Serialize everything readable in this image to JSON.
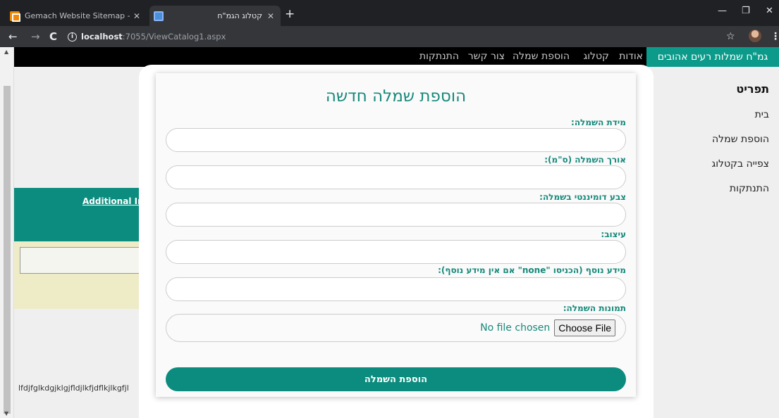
{
  "browser": {
    "tabs": [
      {
        "title": "Gemach Website Sitemap - draw",
        "favicon": "drawio-icon"
      },
      {
        "title": "קטלוג הגמ\"ח",
        "favicon": "page-icon"
      }
    ],
    "new_tab_symbol": "+",
    "address": {
      "host": "localhost",
      "path": ":7055/ViewCatalog1.aspx"
    },
    "window_controls": {
      "minimize": "—",
      "maximize": "❐",
      "close": "✕"
    }
  },
  "nav": {
    "brand": "גמ\"ח שמלות רעים אהובים",
    "links": [
      "אודות",
      "קטלוג",
      "הוספת שמלה",
      "צור קשר",
      "התנתקות"
    ]
  },
  "sidebar": {
    "title": "תפריט",
    "items": [
      "בית",
      "הוספת שמלה",
      "צפייה בקטלוג",
      "התנתקות"
    ]
  },
  "background": {
    "additional_info": "Additional Info",
    "text_row": "lfdjfglkdgjklgjfldjlkfjdflkjlkgfjl"
  },
  "form": {
    "title": "הוספת שמלה חדשה",
    "fields": [
      {
        "label": "מידת השמלה:",
        "value": ""
      },
      {
        "label": "אורך השמלה (ס\"מ):",
        "value": ""
      },
      {
        "label": "צבע דומיננטי בשמלה:",
        "value": ""
      },
      {
        "label": "עיצוב:",
        "value": ""
      },
      {
        "label": "מידע נוסף (הכניסו \"none\" אם אין מידע נוסף):",
        "value": ""
      }
    ],
    "image_label": "תמונות השמלה:",
    "file_button": "Choose File",
    "file_status": "No file chosen",
    "submit": "הוספת השמלה"
  }
}
